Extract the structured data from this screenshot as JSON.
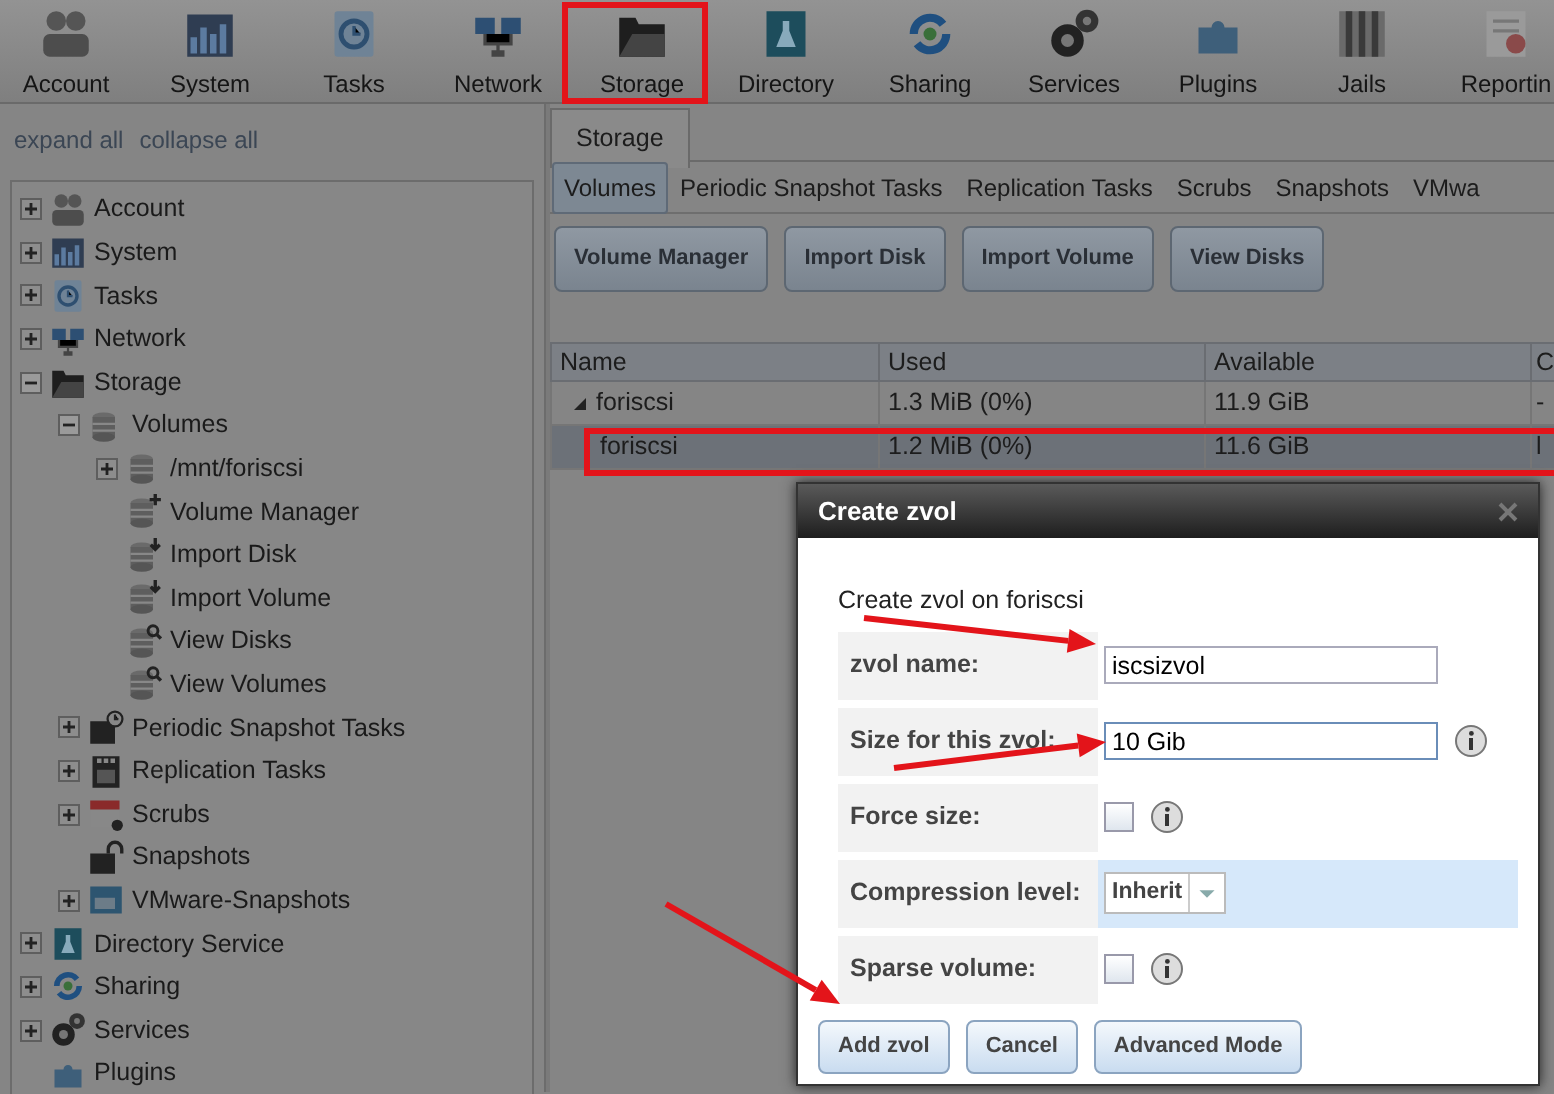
{
  "toolbar": {
    "items": [
      {
        "label": "Account"
      },
      {
        "label": "System"
      },
      {
        "label": "Tasks"
      },
      {
        "label": "Network"
      },
      {
        "label": "Storage"
      },
      {
        "label": "Directory"
      },
      {
        "label": "Sharing"
      },
      {
        "label": "Services"
      },
      {
        "label": "Plugins"
      },
      {
        "label": "Jails"
      },
      {
        "label": "Reportin"
      }
    ]
  },
  "sidebar": {
    "links": [
      "expand all",
      "collapse all"
    ],
    "tree": [
      {
        "label": "Account",
        "kind": "group",
        "expanded": false
      },
      {
        "label": "System",
        "kind": "group",
        "expanded": false
      },
      {
        "label": "Tasks",
        "kind": "group",
        "expanded": false
      },
      {
        "label": "Network",
        "kind": "group",
        "expanded": false
      },
      {
        "label": "Storage",
        "kind": "group",
        "expanded": true,
        "children": [
          {
            "label": "Volumes",
            "kind": "group",
            "expanded": true,
            "children": [
              {
                "label": "/mnt/foriscsi",
                "kind": "group",
                "expanded": false
              },
              {
                "label": "Volume Manager",
                "kind": "leaf"
              },
              {
                "label": "Import Disk",
                "kind": "leaf"
              },
              {
                "label": "Import Volume",
                "kind": "leaf"
              },
              {
                "label": "View Disks",
                "kind": "leaf"
              },
              {
                "label": "View Volumes",
                "kind": "leaf"
              }
            ]
          },
          {
            "label": "Periodic Snapshot Tasks",
            "kind": "group",
            "expanded": false
          },
          {
            "label": "Replication Tasks",
            "kind": "group",
            "expanded": false
          },
          {
            "label": "Scrubs",
            "kind": "group",
            "expanded": false
          },
          {
            "label": "Snapshots",
            "kind": "leaf"
          },
          {
            "label": "VMware-Snapshots",
            "kind": "group",
            "expanded": false
          }
        ]
      },
      {
        "label": "Directory Service",
        "kind": "group",
        "expanded": false
      },
      {
        "label": "Sharing",
        "kind": "group",
        "expanded": false
      },
      {
        "label": "Services",
        "kind": "group",
        "expanded": false
      },
      {
        "label": "Plugins",
        "kind": "leaf"
      }
    ]
  },
  "main": {
    "tabs": [
      {
        "label": "Storage",
        "selected": true
      }
    ],
    "subtabs": [
      {
        "label": "Volumes",
        "selected": true
      },
      {
        "label": "Periodic Snapshot Tasks",
        "selected": false
      },
      {
        "label": "Replication Tasks",
        "selected": false
      },
      {
        "label": "Scrubs",
        "selected": false
      },
      {
        "label": "Snapshots",
        "selected": false
      },
      {
        "label": "VMwa",
        "selected": false
      }
    ],
    "buttons": [
      "Volume Manager",
      "Import Disk",
      "Import Volume",
      "View Disks"
    ],
    "table": {
      "columns": [
        "Name",
        "Used",
        "Available",
        "C"
      ],
      "rows": [
        {
          "cells": [
            "foriscsi",
            "1.3 MiB (0%)",
            "11.9 GiB",
            "-"
          ],
          "expanded": true,
          "selected": false,
          "children": [
            {
              "cells": [
                "foriscsi",
                "1.2 MiB (0%)",
                "11.6 GiB",
                "l"
              ],
              "selected": true
            }
          ]
        }
      ]
    }
  },
  "dialog": {
    "title": "Create zvol",
    "subtitle": "Create zvol on foriscsi",
    "fields": [
      {
        "kind": "text",
        "label": "zvol name:",
        "value": "iscsizvol",
        "focused": false,
        "info": false,
        "highlighted": false
      },
      {
        "kind": "text",
        "label": "Size for this zvol:",
        "value": "10 Gib",
        "focused": true,
        "info": true,
        "highlighted": false
      },
      {
        "kind": "checkbox",
        "label": "Force size:",
        "checked": false,
        "info": true,
        "highlighted": false
      },
      {
        "kind": "select",
        "label": "Compression level:",
        "value": "Inherit",
        "info": false,
        "highlighted": true
      },
      {
        "kind": "checkbox",
        "label": "Sparse volume:",
        "checked": false,
        "info": true,
        "highlighted": false
      }
    ],
    "buttons": [
      "Add zvol",
      "Cancel",
      "Advanced Mode"
    ]
  }
}
